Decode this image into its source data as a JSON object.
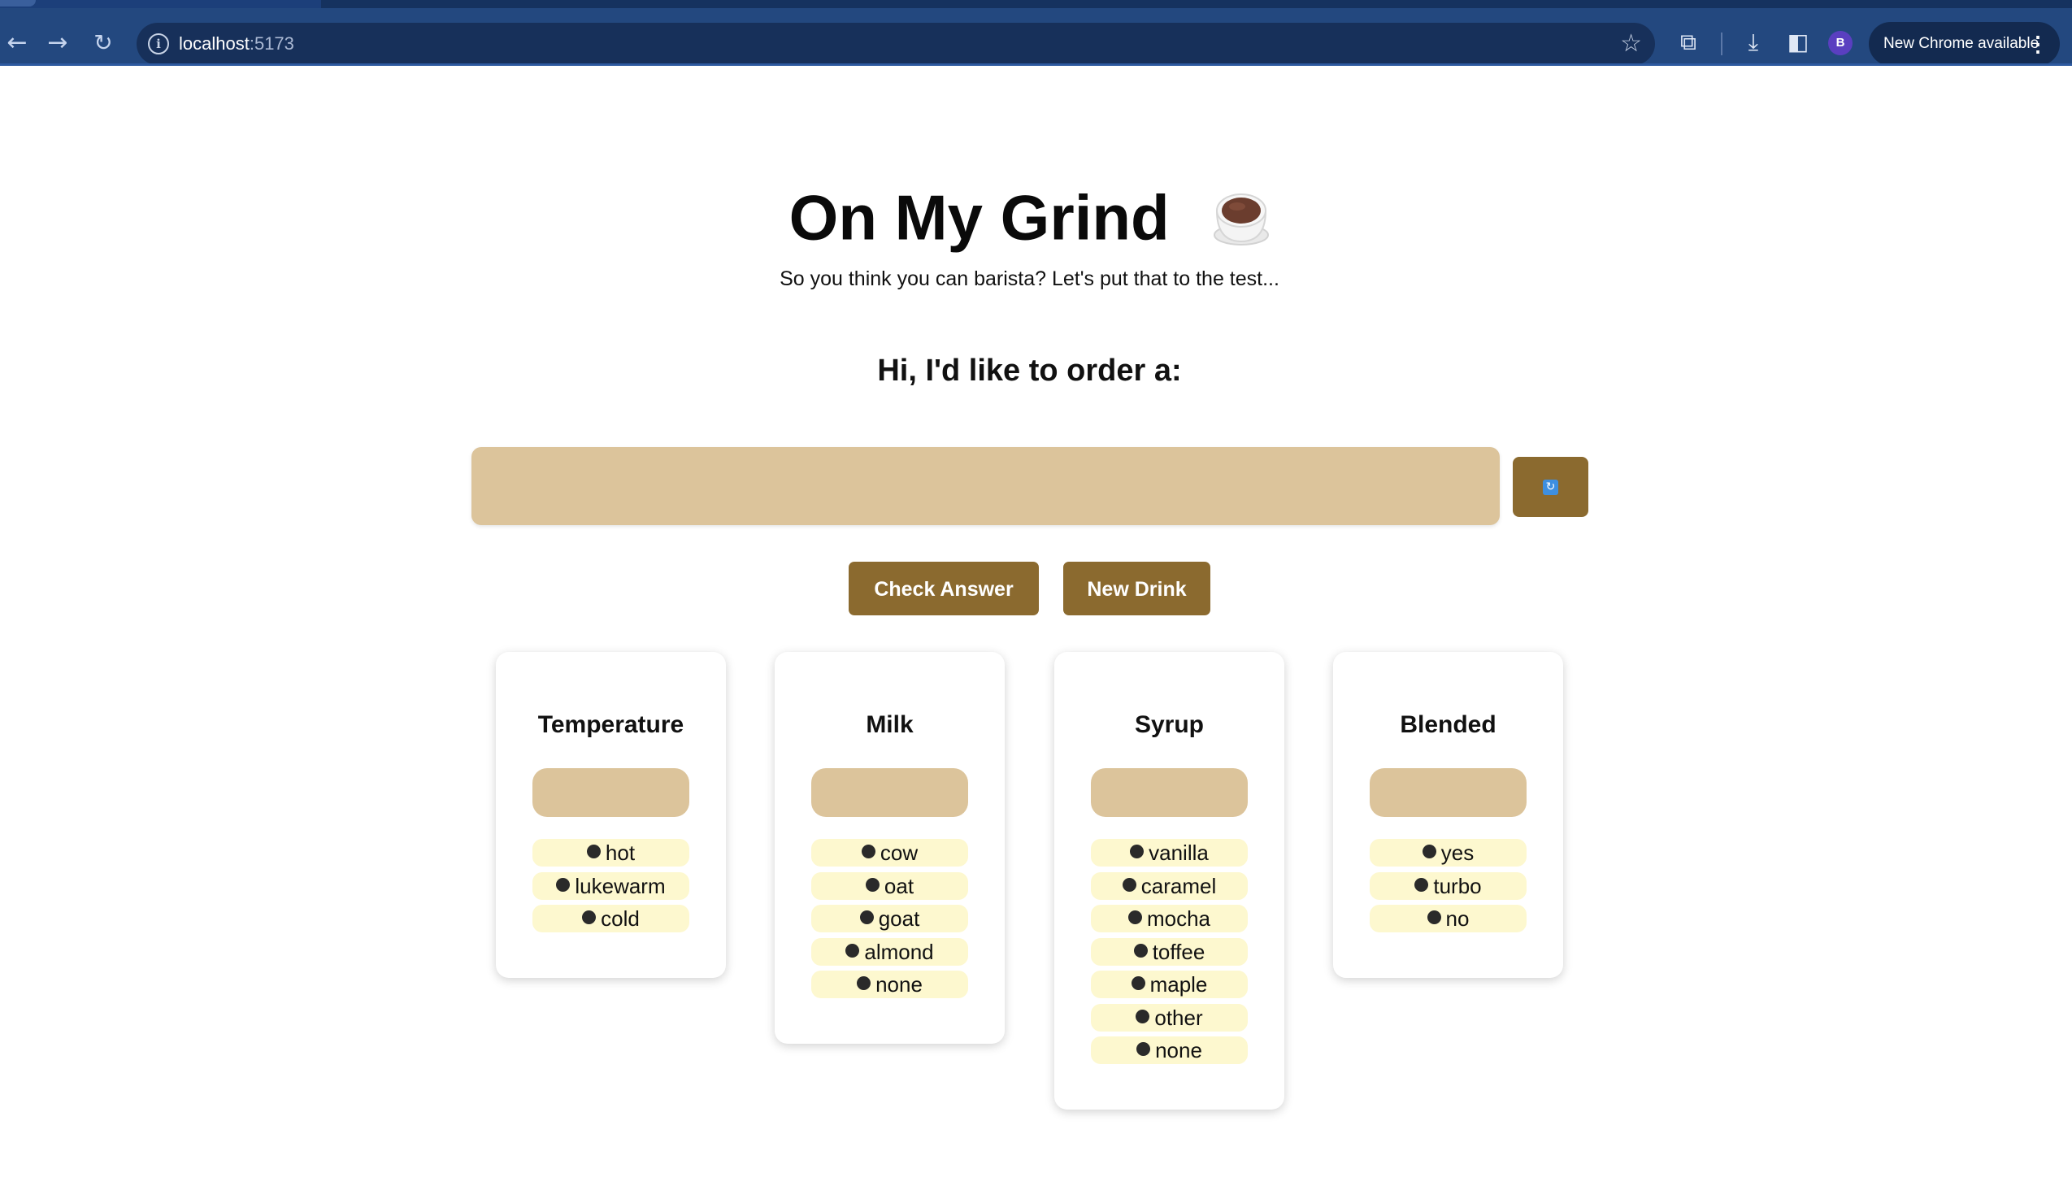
{
  "browser": {
    "url_host": "localhost",
    "url_port": ":5173",
    "profile_initial": "B",
    "update_label": "New Chrome available"
  },
  "header": {
    "title": "On My Grind",
    "subtitle": "So you think you can barista? Let's put that to the test..."
  },
  "order": {
    "prompt": "Hi, I'd like to order a:",
    "input_value": ""
  },
  "buttons": {
    "check_answer": "Check Answer",
    "new_drink": "New Drink"
  },
  "categories": [
    {
      "title": "Temperature",
      "options": [
        "hot",
        "lukewarm",
        "cold"
      ]
    },
    {
      "title": "Milk",
      "options": [
        "cow",
        "oat",
        "goat",
        "almond",
        "none"
      ]
    },
    {
      "title": "Syrup",
      "options": [
        "vanilla",
        "caramel",
        "mocha",
        "toffee",
        "maple",
        "other",
        "none"
      ]
    },
    {
      "title": "Blended",
      "options": [
        "yes",
        "turbo",
        "no"
      ]
    }
  ],
  "colors": {
    "brand_brown": "#8b6a2f",
    "tan_field": "#dcc49b",
    "option_chip": "#fdf8cf",
    "browser_bar": "#23487f"
  }
}
